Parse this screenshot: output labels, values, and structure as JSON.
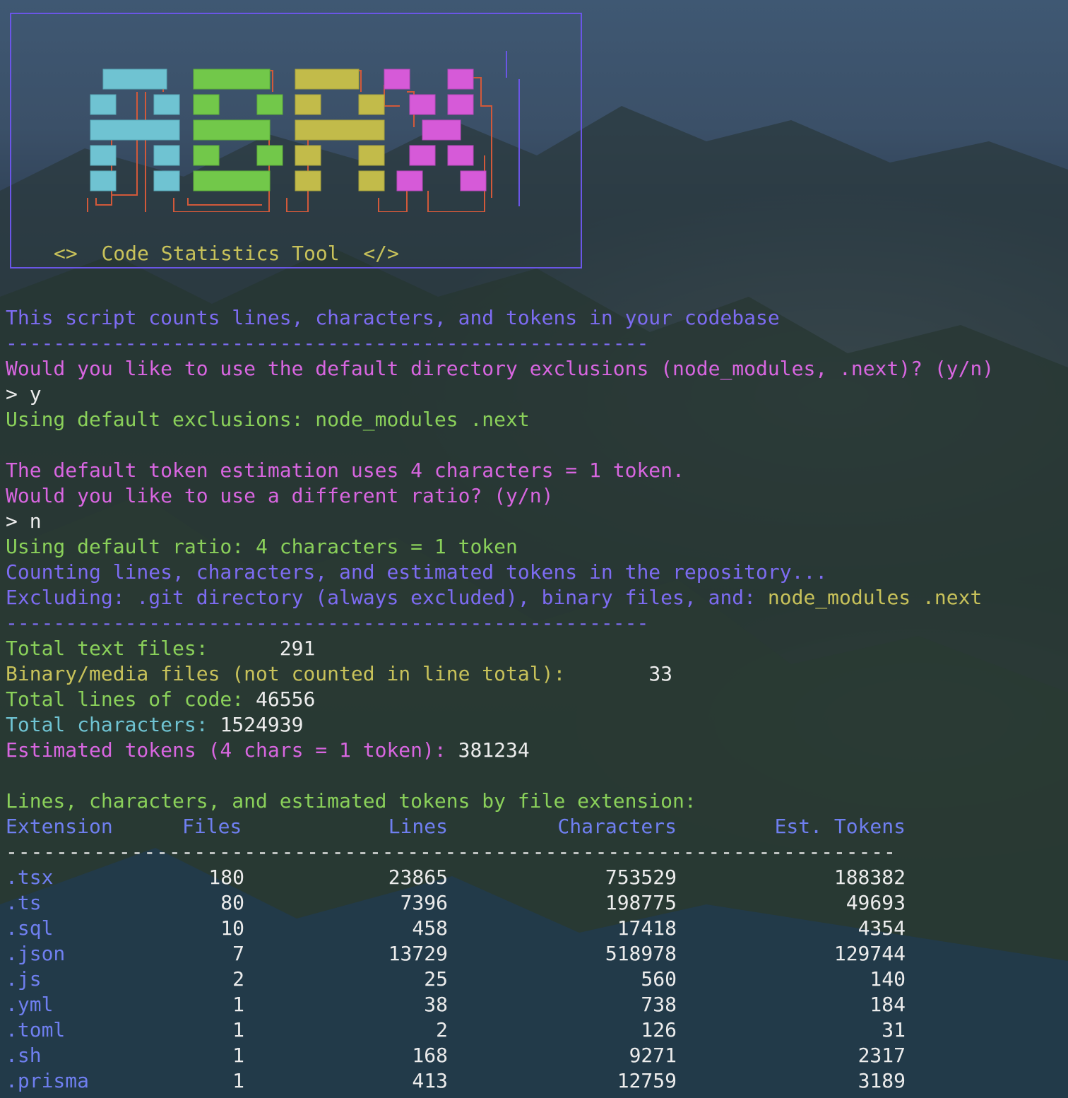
{
  "banner": {
    "logo_text": "AGNX",
    "tagline_open": "<>",
    "tagline": "Code Statistics Tool",
    "tagline_close": "</>"
  },
  "intro": "This script counts lines, characters, and tokens in your codebase",
  "separator": "------------------------------------------------------",
  "prompt_exclusions": "Would you like to use the default directory exclusions (node_modules, .next)? (y/n)",
  "answer_exclusions": "> y",
  "using_exclusions": "Using default exclusions: node_modules .next",
  "token_info": "The default token estimation uses 4 characters = 1 token.",
  "prompt_ratio": "Would you like to use a different ratio? (y/n)",
  "answer_ratio": "> n",
  "using_ratio": "Using default ratio: 4 characters = 1 token",
  "counting": "Counting lines, characters, and estimated tokens in the repository...",
  "excluding_prefix": "Excluding: .git directory (always excluded), binary files, and: ",
  "excluding_dirs": "node_modules .next",
  "stats": {
    "text_files_label": "Total text files:",
    "text_files_value": "291",
    "binary_label": "Binary/media files (not counted in line total):",
    "binary_value": "33",
    "lines_label": "Total lines of code:",
    "lines_value": "46556",
    "chars_label": "Total characters:",
    "chars_value": "1524939",
    "tokens_label": "Estimated tokens (4 chars = 1 token):",
    "tokens_value": "381234"
  },
  "table": {
    "title": "Lines, characters, and estimated tokens by file extension:",
    "headers": [
      "Extension",
      "Files",
      "Lines",
      "Characters",
      "Est. Tokens"
    ],
    "rule": "-----------------------------------------------------------------------",
    "rows": [
      [
        ".tsx",
        "180",
        "23865",
        "753529",
        "188382"
      ],
      [
        ".ts",
        "80",
        "7396",
        "198775",
        "49693"
      ],
      [
        ".sql",
        "10",
        "458",
        "17418",
        "4354"
      ],
      [
        ".json",
        "7",
        "13729",
        "518978",
        "129744"
      ],
      [
        ".js",
        "2",
        "25",
        "560",
        "140"
      ],
      [
        ".yml",
        "1",
        "38",
        "738",
        "184"
      ],
      [
        ".toml",
        "1",
        "2",
        "126",
        "31"
      ],
      [
        ".sh",
        "1",
        "168",
        "9271",
        "2317"
      ],
      [
        ".prisma",
        "1",
        "413",
        "12759",
        "3189"
      ]
    ]
  },
  "colors": {
    "purple": "#7d6cf2",
    "magenta": "#d866e0",
    "green": "#8ad05a",
    "yellow": "#c8c25a",
    "cyan": "#6fc3d2",
    "border": "#6a56e6",
    "logo_outline": "#d2593a"
  }
}
